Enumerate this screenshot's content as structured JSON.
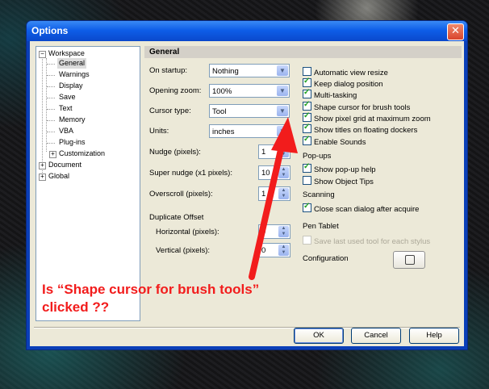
{
  "window": {
    "title": "Options"
  },
  "tree": {
    "items": [
      {
        "label": "Workspace",
        "expander": "−"
      },
      {
        "label": "General"
      },
      {
        "label": "Warnings"
      },
      {
        "label": "Display"
      },
      {
        "label": "Save"
      },
      {
        "label": "Text"
      },
      {
        "label": "Memory"
      },
      {
        "label": "VBA"
      },
      {
        "label": "Plug-ins"
      },
      {
        "label": "Customization",
        "expander": "+"
      },
      {
        "label": "Document",
        "expander": "+"
      },
      {
        "label": "Global",
        "expander": "+"
      }
    ]
  },
  "panel": {
    "title": "General",
    "on_startup": {
      "label": "On startup:",
      "value": "Nothing"
    },
    "opening_zoom": {
      "label": "Opening zoom:",
      "value": "100%"
    },
    "cursor_type": {
      "label": "Cursor type:",
      "value": "Tool"
    },
    "units": {
      "label": "Units:",
      "value": "inches"
    },
    "nudge": {
      "label": "Nudge (pixels):",
      "value": "1"
    },
    "super_nudge": {
      "label": "Super nudge (x1 pixels):",
      "value": "10"
    },
    "overscroll": {
      "label": "Overscroll (pixels):",
      "value": "1"
    },
    "duplicate_offset": {
      "heading": "Duplicate Offset",
      "horizontal": {
        "label": "Horizontal (pixels):",
        "value": "0"
      },
      "vertical": {
        "label": "Vertical (pixels):",
        "value": "0"
      }
    },
    "checkboxes": [
      {
        "label": "Automatic view resize",
        "checked": false
      },
      {
        "label": "Keep dialog position",
        "checked": true
      },
      {
        "label": "Multi-tasking",
        "checked": true
      },
      {
        "label": "Shape cursor for brush tools",
        "checked": true
      },
      {
        "label": "Show pixel grid at maximum zoom",
        "checked": true
      },
      {
        "label": "Show titles on floating dockers",
        "checked": true
      },
      {
        "label": "Enable Sounds",
        "checked": true
      }
    ],
    "popups": {
      "heading": "Pop-ups",
      "items": [
        {
          "label": "Show pop-up help",
          "checked": true
        },
        {
          "label": "Show Object Tips",
          "checked": false
        }
      ]
    },
    "scanning": {
      "heading": "Scanning",
      "items": [
        {
          "label": "Close scan dialog after acquire",
          "checked": true
        }
      ]
    },
    "pen_tablet": {
      "heading": "Pen Tablet",
      "items": [
        {
          "label": "Save last used tool for each stylus",
          "checked": false,
          "disabled": true
        }
      ]
    },
    "configuration": {
      "label": "Configuration"
    }
  },
  "buttons": {
    "ok": "OK",
    "cancel": "Cancel",
    "help": "Help"
  },
  "annotation": {
    "line1": "Is “Shape cursor for brush tools”",
    "line2": "clicked ??",
    "color": "#f21c1c"
  }
}
